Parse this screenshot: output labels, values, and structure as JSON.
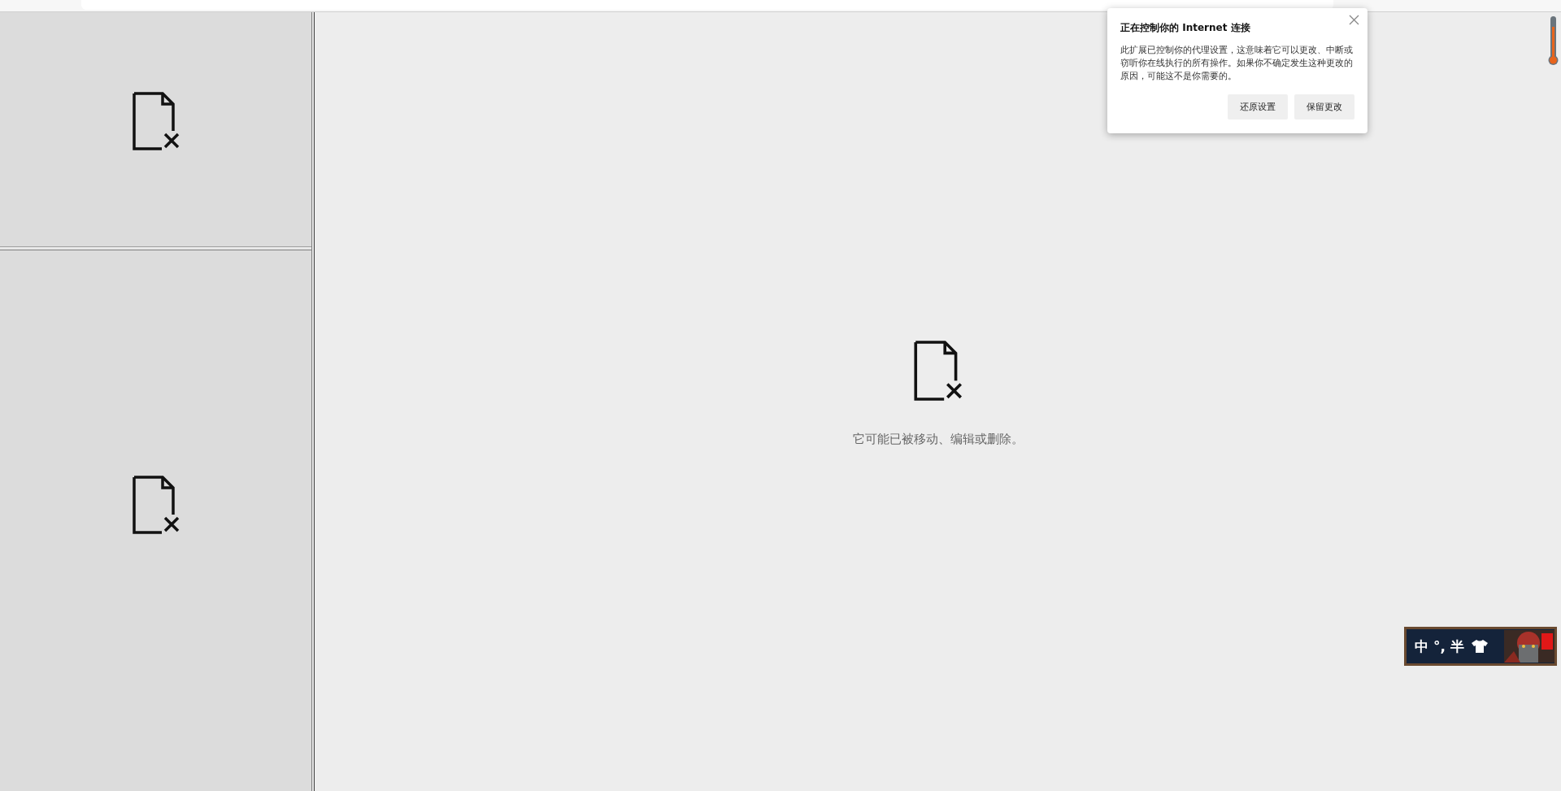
{
  "main": {
    "message": "它可能已被移动、编辑或删除。"
  },
  "popup": {
    "title": "正在控制你的 Internet 连接",
    "body": "此扩展已控制你的代理设置，这意味着它可以更改、中断或窃听你在线执行的所有操作。如果你不确定发生这种更改的原因，可能这不是你需要的。",
    "buttons": [
      "还原设置",
      "保留更改"
    ]
  },
  "ime": {
    "labels": [
      "中",
      "°,",
      "半"
    ]
  }
}
